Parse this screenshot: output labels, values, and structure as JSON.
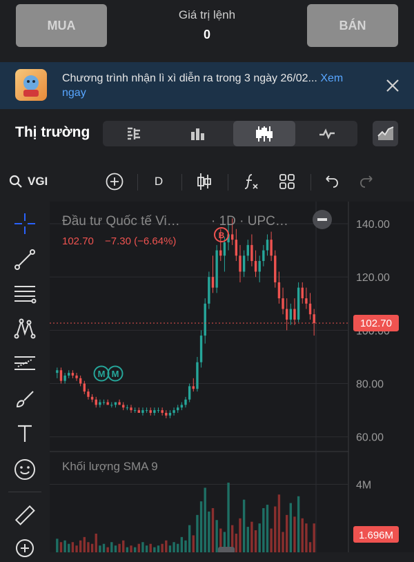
{
  "top": {
    "buy_label": "MUA",
    "sell_label": "BÁN",
    "order_value_label": "Giá trị lệnh",
    "order_value": "0"
  },
  "banner": {
    "text": "Chương trình nhận lì xì diễn ra trong 3 ngày 26/02... ",
    "link_part1": "Xem",
    "link_part2": "ngay"
  },
  "market": {
    "title": "Thị trường",
    "tabs": [
      "orderbook-icon",
      "bar-chart-icon",
      "candlestick-icon",
      "line-chart-icon"
    ],
    "active_tab": 2
  },
  "toolbar": {
    "symbol": "VGI",
    "interval": "D",
    "items": [
      "search-icon",
      "add-icon",
      "interval",
      "indicator-candle-icon",
      "function-icon",
      "layout-grid-icon",
      "undo-icon",
      "redo-icon"
    ]
  },
  "chart": {
    "title": "Đầu tư Quốc tế Vi…",
    "interval_exchange": "· 1D · UPC…",
    "price": "102.70",
    "change": "−7.30 (−6.64%)",
    "current_price_label": "102.70",
    "volume_title": "Khối lượng SMA 9",
    "volume_current_label": "1.696M",
    "colors": {
      "up": "#26a69a",
      "down": "#ef5350",
      "accent": "#2962ff"
    },
    "marker_b": "B",
    "marker_m": "M"
  },
  "chart_data": {
    "type": "candlestick",
    "price_axis": {
      "ticks": [
        "140.00",
        "120.00",
        "100.00",
        "80.00",
        "60.00"
      ],
      "ylim": [
        55,
        147
      ]
    },
    "volume_axis": {
      "ticks": [
        "4M"
      ]
    },
    "candles": [
      [
        84,
        86,
        82,
        85
      ],
      [
        85,
        86,
        80,
        81
      ],
      [
        81,
        84,
        80,
        83
      ],
      [
        83,
        85,
        82,
        84
      ],
      [
        84,
        85,
        82,
        83
      ],
      [
        83,
        84,
        81,
        82
      ],
      [
        82,
        83,
        79,
        80
      ],
      [
        80,
        81,
        76,
        77
      ],
      [
        77,
        78,
        74,
        75
      ],
      [
        75,
        76,
        73,
        74
      ],
      [
        74,
        75,
        71,
        72
      ],
      [
        72,
        74,
        71,
        73
      ],
      [
        73,
        74,
        72,
        73
      ],
      [
        73,
        74,
        72,
        72
      ],
      [
        72,
        73,
        71,
        72
      ],
      [
        72,
        73,
        71,
        73
      ],
      [
        73,
        74,
        72,
        72
      ],
      [
        72,
        73,
        70,
        71
      ],
      [
        71,
        72,
        70,
        71
      ],
      [
        71,
        72,
        69,
        70
      ],
      [
        70,
        71,
        69,
        70
      ],
      [
        70,
        71,
        69,
        69
      ],
      [
        69,
        71,
        68,
        70
      ],
      [
        70,
        71,
        69,
        70
      ],
      [
        70,
        71,
        68,
        69
      ],
      [
        69,
        71,
        68,
        70
      ],
      [
        70,
        71,
        69,
        70
      ],
      [
        70,
        71,
        68,
        69
      ],
      [
        69,
        70,
        67,
        68
      ],
      [
        68,
        70,
        67,
        69
      ],
      [
        69,
        71,
        68,
        70
      ],
      [
        70,
        72,
        69,
        71
      ],
      [
        71,
        73,
        70,
        72
      ],
      [
        72,
        75,
        71,
        74
      ],
      [
        74,
        80,
        73,
        79
      ],
      [
        79,
        82,
        77,
        78
      ],
      [
        78,
        90,
        77,
        88
      ],
      [
        88,
        100,
        86,
        98
      ],
      [
        98,
        112,
        95,
        110
      ],
      [
        110,
        122,
        108,
        120
      ],
      [
        120,
        128,
        114,
        116
      ],
      [
        116,
        132,
        114,
        130
      ],
      [
        130,
        138,
        126,
        128
      ],
      [
        128,
        135,
        122,
        133
      ],
      [
        133,
        140,
        130,
        136
      ],
      [
        136,
        142,
        132,
        134
      ],
      [
        134,
        138,
        126,
        128
      ],
      [
        128,
        132,
        118,
        122
      ],
      [
        122,
        130,
        120,
        128
      ],
      [
        128,
        134,
        126,
        132
      ],
      [
        132,
        136,
        124,
        126
      ],
      [
        126,
        130,
        120,
        122
      ],
      [
        122,
        128,
        118,
        126
      ],
      [
        126,
        132,
        124,
        130
      ],
      [
        130,
        136,
        128,
        134
      ],
      [
        134,
        137,
        126,
        128
      ],
      [
        128,
        130,
        116,
        118
      ],
      [
        118,
        122,
        110,
        112
      ],
      [
        112,
        116,
        106,
        108
      ],
      [
        108,
        112,
        100,
        104
      ],
      [
        104,
        110,
        102,
        108
      ],
      [
        108,
        112,
        102,
        104
      ],
      [
        104,
        118,
        103,
        116
      ],
      [
        116,
        118,
        110,
        112
      ],
      [
        112,
        116,
        108,
        110
      ],
      [
        110,
        114,
        104,
        106
      ],
      [
        106,
        108,
        98,
        102.7
      ]
    ],
    "volumes": [
      0.8,
      0.6,
      0.7,
      0.5,
      0.6,
      0.4,
      0.7,
      0.9,
      0.6,
      0.5,
      1.1,
      0.4,
      0.5,
      0.3,
      0.6,
      0.4,
      0.5,
      0.7,
      0.3,
      0.4,
      0.3,
      0.5,
      0.6,
      0.4,
      0.5,
      0.3,
      0.4,
      0.5,
      0.7,
      0.4,
      0.6,
      0.5,
      0.9,
      0.7,
      1.6,
      1.0,
      2.2,
      3.0,
      3.8,
      2.4,
      2.6,
      1.9,
      1.4,
      1.2,
      4.1,
      1.6,
      1.1,
      2.0,
      3.1,
      1.5,
      1.8,
      1.3,
      1.7,
      2.6,
      2.8,
      1.4,
      2.7,
      3.4,
      1.2,
      2.2,
      2.9,
      2.1,
      3.3,
      2.0,
      1.7,
      0.6,
      1.7
    ]
  }
}
